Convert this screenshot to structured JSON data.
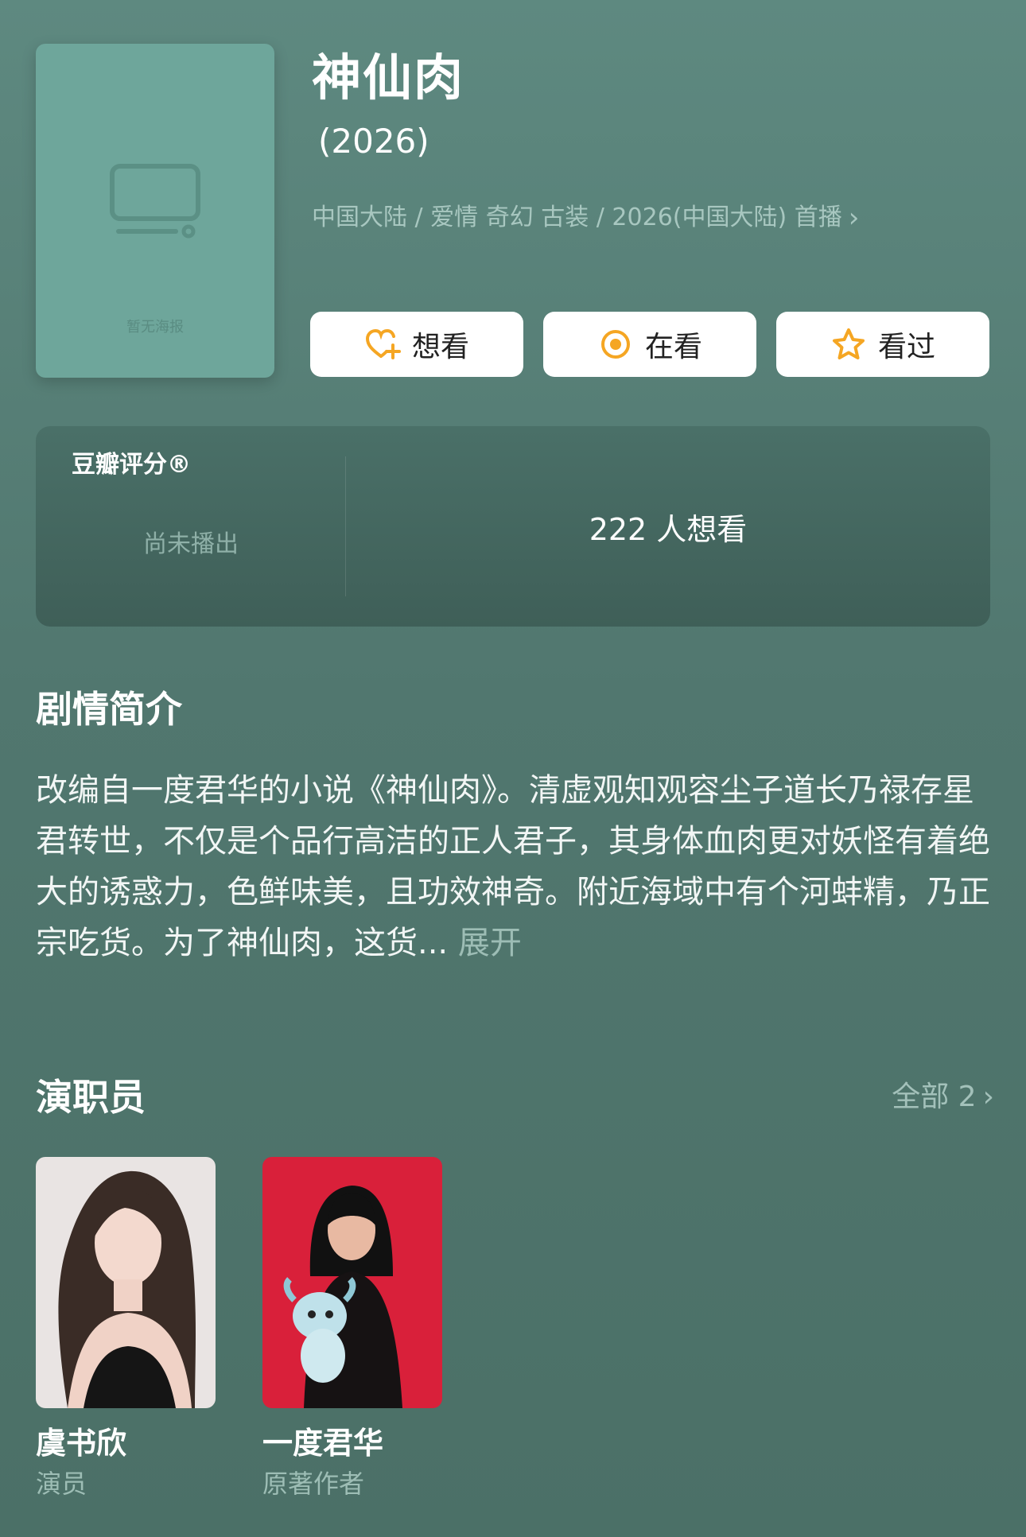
{
  "poster": {
    "caption": "暂无海报"
  },
  "header": {
    "title": "神仙肉",
    "year": "(2026)",
    "meta": "中国大陆 / 爱情 奇幻 古装 / 2026(中国大陆) 首播"
  },
  "actions": {
    "want": "想看",
    "watching": "在看",
    "watched": "看过",
    "icon_color": "#f5a623"
  },
  "rating": {
    "label": "豆瓣评分®",
    "status": "尚未播出",
    "want_count": "222 人想看"
  },
  "synopsis": {
    "title": "剧情简介",
    "text": "改编自一度君华的小说《神仙肉》。清虚观知观容尘子道长乃禄存星君转世，不仅是个品行高洁的正人君子，其身体血肉更对妖怪有着绝大的诱惑力，色鲜味美，且功效神奇。附近海域中有个河蚌精，乃正宗吃货。为了神仙肉，这货...",
    "expand": "展开"
  },
  "cast": {
    "title": "演职员",
    "see_all": "全部 2",
    "members": [
      {
        "name": "虞书欣",
        "role": "演员"
      },
      {
        "name": "一度君华",
        "role": "原著作者"
      }
    ]
  }
}
